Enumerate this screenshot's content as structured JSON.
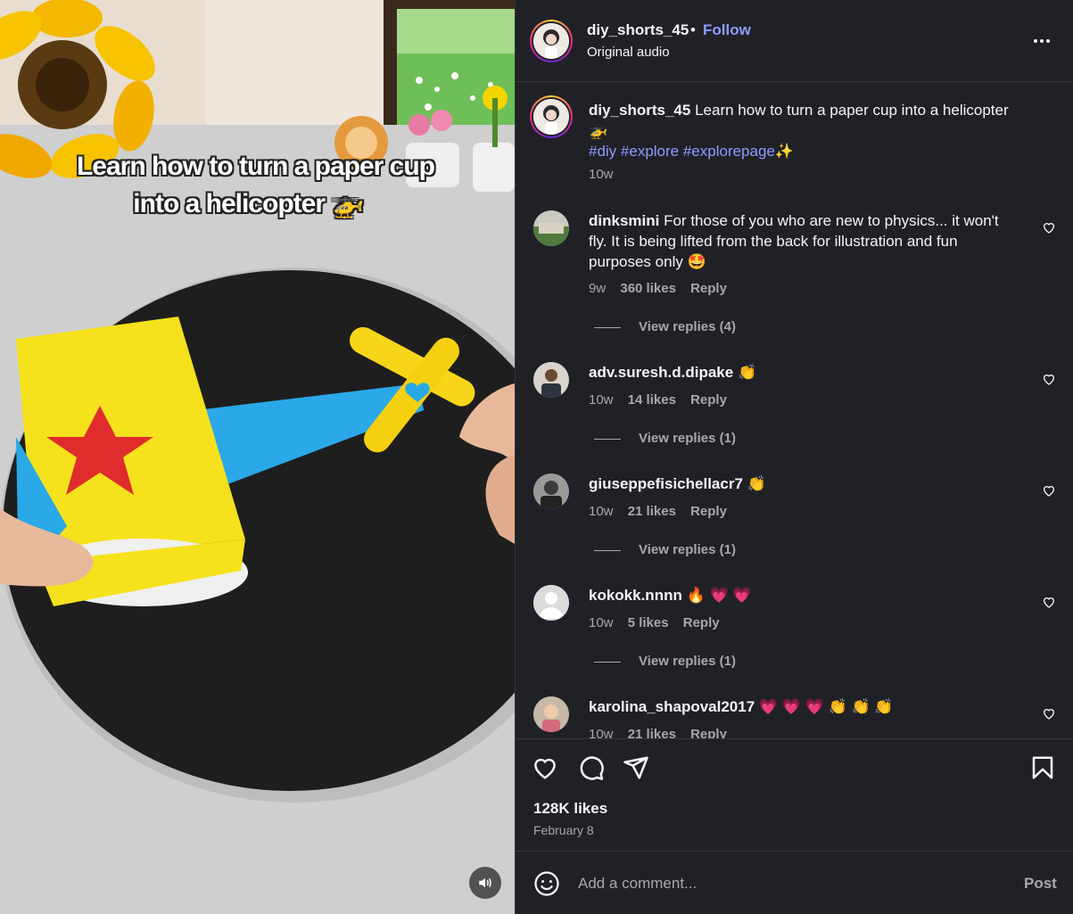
{
  "video": {
    "caption_line1": "Learn how to turn a paper cup",
    "caption_line2": "into a helicopter 🚁"
  },
  "header": {
    "username": "diy_shorts_45",
    "separator": "•",
    "follow_label": "Follow",
    "audio_label": "Original audio"
  },
  "post": {
    "username": "diy_shorts_45",
    "text": "Learn how to turn a paper cup into a helicopter 🚁",
    "hashtags": "#diy #explore #explorepage✨",
    "time": "10w"
  },
  "comments": [
    {
      "username": "dinksmini",
      "text": "For those of you who are new to physics... it won't fly. It is being lifted from the back for illustration and fun purposes only 🤩",
      "time": "9w",
      "likes": "360 likes",
      "reply_label": "Reply",
      "view_replies": "View replies (4)"
    },
    {
      "username": "adv.suresh.d.dipake",
      "text": "👏",
      "time": "10w",
      "likes": "14 likes",
      "reply_label": "Reply",
      "view_replies": "View replies (1)"
    },
    {
      "username": "giuseppefisichellacr7",
      "text": "👏",
      "time": "10w",
      "likes": "21 likes",
      "reply_label": "Reply",
      "view_replies": "View replies (1)"
    },
    {
      "username": "kokokk.nnnn",
      "text": "🔥 💗 💗",
      "time": "10w",
      "likes": "5 likes",
      "reply_label": "Reply",
      "view_replies": "View replies (1)"
    },
    {
      "username": "karolina_shapoval2017",
      "text": "💗 💗 💗 👏 👏 👏",
      "time": "10w",
      "likes": "21 likes",
      "reply_label": "Reply"
    }
  ],
  "actions": {
    "likes": "128K likes",
    "date": "February 8"
  },
  "add_comment": {
    "placeholder": "Add a comment...",
    "post_label": "Post"
  },
  "colors": {
    "panel_bg": "#202127",
    "link": "#8c9dff",
    "muted": "#a8a8a8"
  }
}
